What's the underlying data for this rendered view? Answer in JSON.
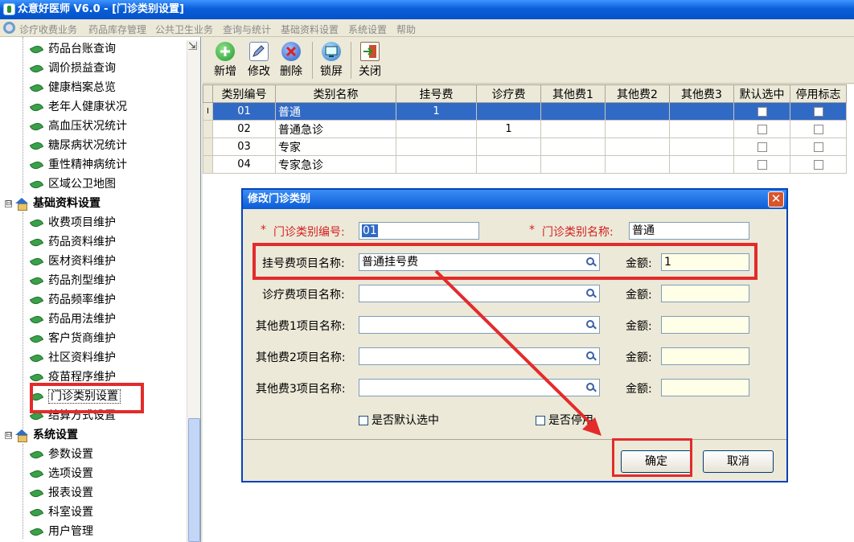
{
  "window": {
    "title": "众意好医师 V6.0 - [门诊类别设置]"
  },
  "menu": [
    "诊疗收费业务",
    "药品库存管理",
    "公共卫生业务",
    "查询与统计",
    "基础资料设置",
    "系统设置",
    "帮助"
  ],
  "sidebar": {
    "items_top": [
      "药品台账查询",
      "调价损益查询",
      "健康档案总览",
      "老年人健康状况",
      "高血压状况统计",
      "糖尿病状况统计",
      "重性精神病统计",
      "区域公卫地图"
    ],
    "group1": "基础资料设置",
    "items_group1": [
      "收费项目维护",
      "药品资料维护",
      "医材资料维护",
      "药品剂型维护",
      "药品频率维护",
      "药品用法维护",
      "客户货商维护",
      "社区资料维护",
      "疫苗程序维护",
      "门诊类别设置",
      "结算方式设置"
    ],
    "group2": "系统设置",
    "items_group2": [
      "参数设置",
      "选项设置",
      "报表设置",
      "科室设置",
      "用户管理"
    ],
    "expander": "⊟"
  },
  "toolbar": {
    "new": "新增",
    "edit": "修改",
    "delete": "删除",
    "lock": "锁屏",
    "close": "关闭"
  },
  "grid": {
    "columns": [
      "类别编号",
      "类别名称",
      "挂号费",
      "诊疗费",
      "其他费1",
      "其他费2",
      "其他费3",
      "默认选中",
      "停用标志"
    ],
    "current_row_marker": "I",
    "rows": [
      {
        "code": "01",
        "name": "普通",
        "reg": "1",
        "diag": "",
        "o1": "",
        "o2": "",
        "o3": ""
      },
      {
        "code": "02",
        "name": "普通急诊",
        "reg": "",
        "diag": "1",
        "o1": "",
        "o2": "",
        "o3": ""
      },
      {
        "code": "03",
        "name": "专家",
        "reg": "",
        "diag": "",
        "o1": "",
        "o2": "",
        "o3": ""
      },
      {
        "code": "04",
        "name": "专家急诊",
        "reg": "",
        "diag": "",
        "o1": "",
        "o2": "",
        "o3": ""
      }
    ]
  },
  "dialog": {
    "title": "修改门诊类别",
    "close_symbol": "✕",
    "required_mark": "*",
    "code_label": "门诊类别编号:",
    "code_value": "01",
    "name_label": "门诊类别名称:",
    "name_value": "普通",
    "reg_label": "挂号费项目名称:",
    "reg_value": "普通挂号费",
    "diag_label": "诊疗费项目名称:",
    "o1_label": "其他费1项目名称:",
    "o2_label": "其他费2项目名称:",
    "o3_label": "其他费3项目名称:",
    "amount_label": "金额:",
    "reg_amount": "1",
    "default_check": "是否默认选中",
    "disable_check": "是否停用",
    "ok": "确定",
    "cancel": "取消"
  },
  "colors": {
    "annotation": "#e32b2b",
    "selection": "#316ac5",
    "title_blue": "#0a5fd8"
  }
}
